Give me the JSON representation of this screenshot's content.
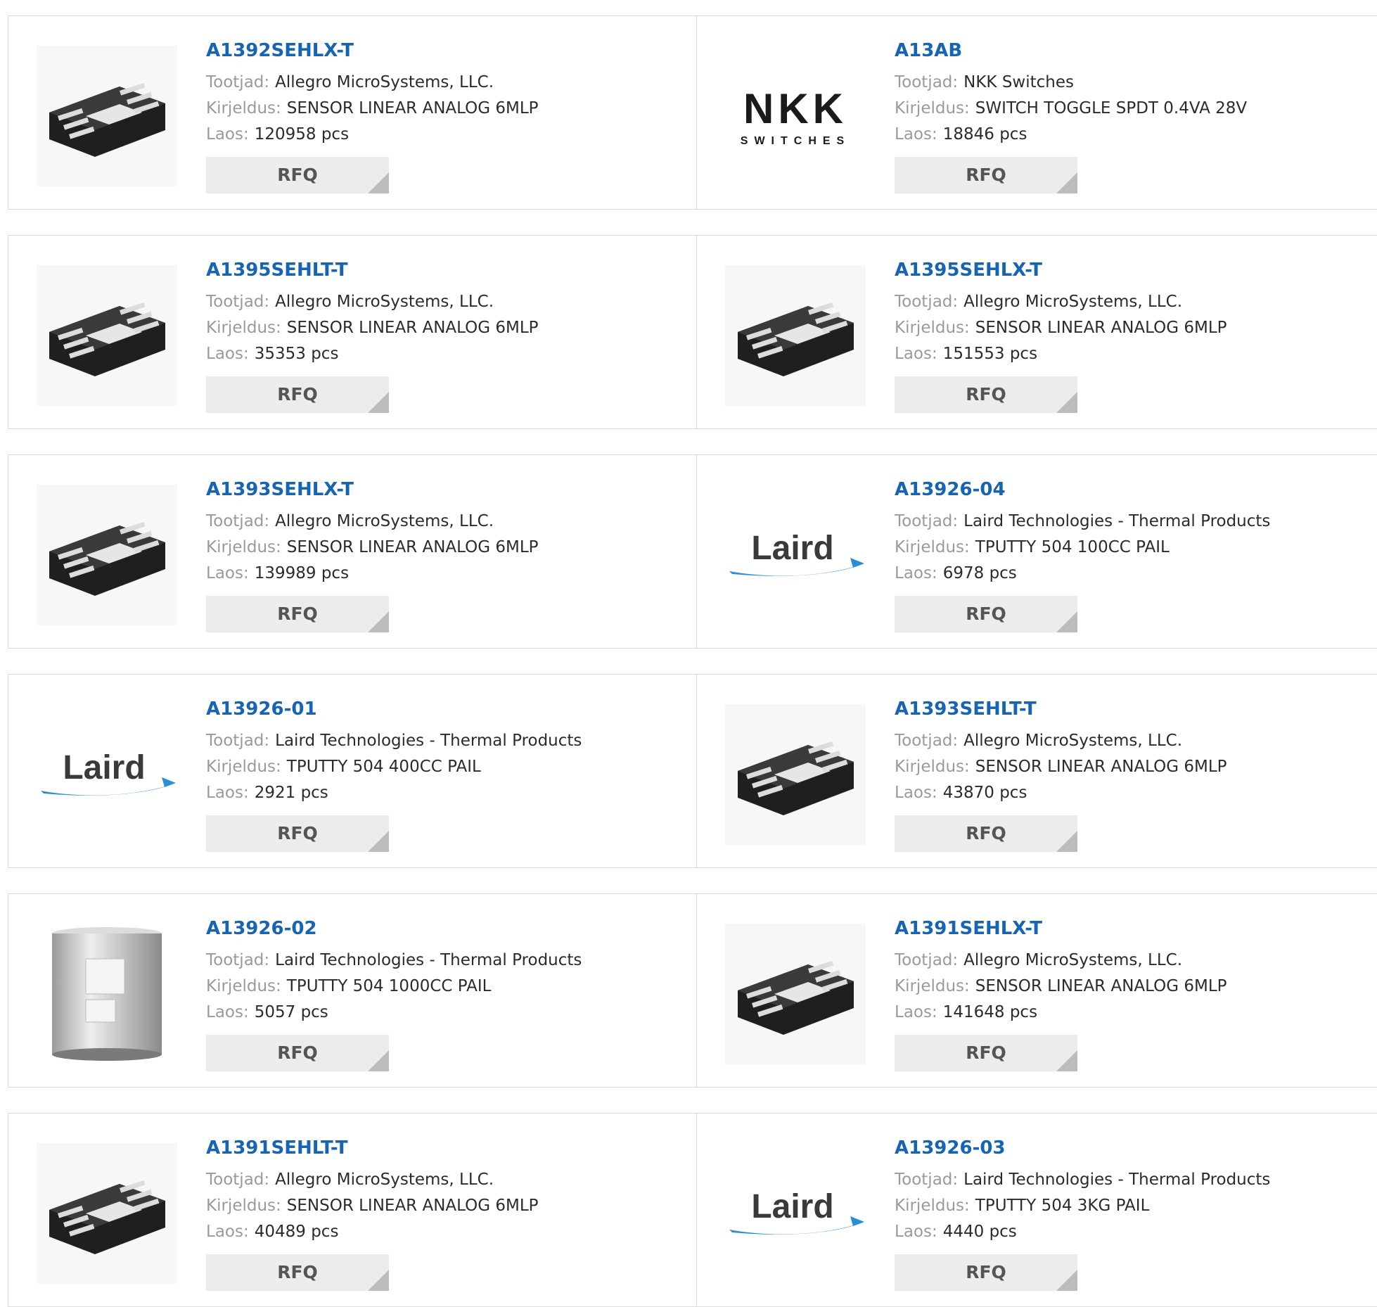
{
  "labels": {
    "manufacturer": "Tootjad:",
    "description": "Kirjeldus:",
    "stock": "Laos:",
    "rfq": "RFQ"
  },
  "colors": {
    "link": "#1565b4",
    "label": "#9a9a9a",
    "value": "#2b2b2b",
    "button_bg": "#ececec",
    "border": "#d9d9d9"
  },
  "products": [
    {
      "part": "A1392SEHLX-T",
      "image": "ic-chip",
      "manufacturer": "Allegro MicroSystems, LLC.",
      "description": "SENSOR LINEAR ANALOG 6MLP",
      "stock": "120958 pcs"
    },
    {
      "part": "A13AB",
      "image": "nkk-logo",
      "logo_text": "NKK",
      "logo_sub": "SWITCHES",
      "manufacturer": "NKK Switches",
      "description": "SWITCH TOGGLE SPDT 0.4VA 28V",
      "stock": "18846 pcs"
    },
    {
      "part": "A1395SEHLT-T",
      "image": "ic-chip",
      "manufacturer": "Allegro MicroSystems, LLC.",
      "description": "SENSOR LINEAR ANALOG 6MLP",
      "stock": "35353 pcs"
    },
    {
      "part": "A1395SEHLX-T",
      "image": "ic-chip",
      "manufacturer": "Allegro MicroSystems, LLC.",
      "description": "SENSOR LINEAR ANALOG 6MLP",
      "stock": "151553 pcs"
    },
    {
      "part": "A1393SEHLX-T",
      "image": "ic-chip",
      "manufacturer": "Allegro MicroSystems, LLC.",
      "description": "SENSOR LINEAR ANALOG 6MLP",
      "stock": "139989 pcs"
    },
    {
      "part": "A13926-04",
      "image": "laird-logo",
      "logo_text": "Laird",
      "manufacturer": "Laird Technologies - Thermal Products",
      "description": "TPUTTY 504 100CC PAIL",
      "stock": "6978 pcs"
    },
    {
      "part": "A13926-01",
      "image": "laird-logo",
      "logo_text": "Laird",
      "manufacturer": "Laird Technologies - Thermal Products",
      "description": "TPUTTY 504 400CC PAIL",
      "stock": "2921 pcs"
    },
    {
      "part": "A1393SEHLT-T",
      "image": "ic-chip",
      "manufacturer": "Allegro MicroSystems, LLC.",
      "description": "SENSOR LINEAR ANALOG 6MLP",
      "stock": "43870 pcs"
    },
    {
      "part": "A13926-02",
      "image": "pail",
      "manufacturer": "Laird Technologies - Thermal Products",
      "description": "TPUTTY 504 1000CC PAIL",
      "stock": "5057 pcs"
    },
    {
      "part": "A1391SEHLX-T",
      "image": "ic-chip",
      "manufacturer": "Allegro MicroSystems, LLC.",
      "description": "SENSOR LINEAR ANALOG 6MLP",
      "stock": "141648 pcs"
    },
    {
      "part": "A1391SEHLT-T",
      "image": "ic-chip",
      "manufacturer": "Allegro MicroSystems, LLC.",
      "description": "SENSOR LINEAR ANALOG 6MLP",
      "stock": "40489 pcs"
    },
    {
      "part": "A13926-03",
      "image": "laird-logo",
      "logo_text": "Laird",
      "manufacturer": "Laird Technologies - Thermal Products",
      "description": "TPUTTY 504 3KG PAIL",
      "stock": "4440 pcs"
    }
  ]
}
